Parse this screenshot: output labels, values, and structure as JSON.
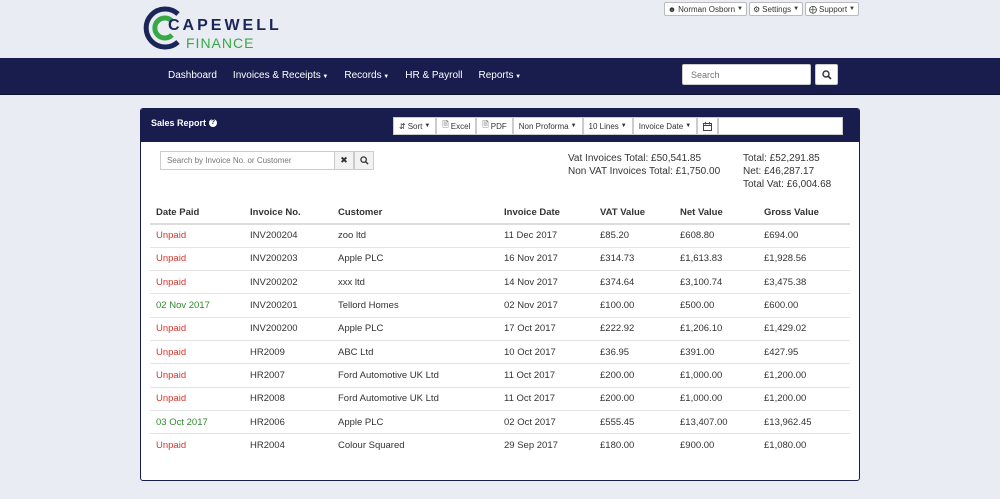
{
  "brand": {
    "line1": "CAPEWELL",
    "line2": "FINANCE",
    "color_primary": "#1b2557",
    "color_accent": "#36a945"
  },
  "user_menu": [
    {
      "icon": "user-icon",
      "label": "Norman Osborn"
    },
    {
      "icon": "gear-icon",
      "label": "Settings"
    },
    {
      "icon": "lifebuoy-icon",
      "label": "Support"
    }
  ],
  "nav": {
    "items": [
      "Dashboard",
      "Invoices & Receipts",
      "Records",
      "HR & Payroll",
      "Reports"
    ],
    "search_placeholder": "Search"
  },
  "panel": {
    "title": "Sales Report",
    "toolbar": {
      "sort": "Sort",
      "excel": "Excel",
      "pdf": "PDF",
      "proforma": "Non Proforma",
      "lines": "10 Lines",
      "date_field": "Invoice Date"
    },
    "filter_placeholder": "Search by Invoice No. or Customer",
    "totals": {
      "vat_invoices": "Vat Invoices Total: £50,541.85",
      "non_vat_invoices": "Non VAT Invoices Total: £1,750.00",
      "total": "Total: £52,291.85",
      "net": "Net: £46,287.17",
      "total_vat": "Total Vat: £6,004.68"
    },
    "columns": [
      "Date Paid",
      "Invoice No.",
      "Customer",
      "Invoice Date",
      "VAT Value",
      "Net Value",
      "Gross Value"
    ],
    "rows": [
      [
        "Unpaid",
        "INV200204",
        "zoo ltd",
        "11 Dec 2017",
        "£85.20",
        "£608.80",
        "£694.00"
      ],
      [
        "Unpaid",
        "INV200203",
        "Apple PLC",
        "16 Nov 2017",
        "£314.73",
        "£1,613.83",
        "£1,928.56"
      ],
      [
        "Unpaid",
        "INV200202",
        "xxx ltd",
        "14 Nov 2017",
        "£374.64",
        "£3,100.74",
        "£3,475.38"
      ],
      [
        "02 Nov 2017",
        "INV200201",
        "Tellord Homes",
        "02 Nov 2017",
        "£100.00",
        "£500.00",
        "£600.00"
      ],
      [
        "Unpaid",
        "INV200200",
        "Apple PLC",
        "17 Oct 2017",
        "£222.92",
        "£1,206.10",
        "£1,429.02"
      ],
      [
        "Unpaid",
        "HR2009",
        "ABC Ltd",
        "10 Oct 2017",
        "£36.95",
        "£391.00",
        "£427.95"
      ],
      [
        "Unpaid",
        "HR2007",
        "Ford Automotive UK Ltd",
        "11 Oct 2017",
        "£200.00",
        "£1,000.00",
        "£1,200.00"
      ],
      [
        "Unpaid",
        "HR2008",
        "Ford Automotive UK Ltd",
        "11 Oct 2017",
        "£200.00",
        "£1,000.00",
        "£1,200.00"
      ],
      [
        "03 Oct 2017",
        "HR2006",
        "Apple PLC",
        "02 Oct 2017",
        "£555.45",
        "£13,407.00",
        "£13,962.45"
      ],
      [
        "Unpaid",
        "HR2004",
        "Colour Squared",
        "29 Sep 2017",
        "£180.00",
        "£900.00",
        "£1,080.00"
      ]
    ]
  }
}
